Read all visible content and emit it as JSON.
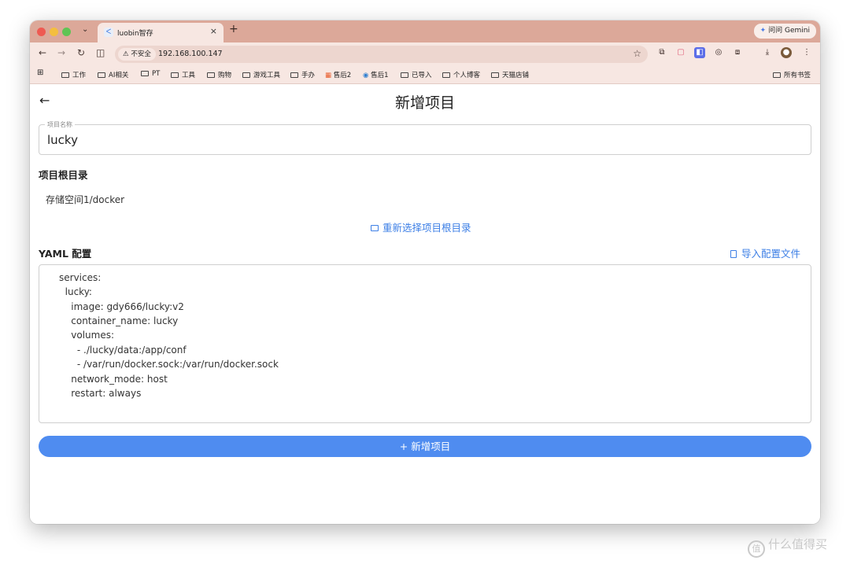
{
  "browser": {
    "tab_title": "luobin智存",
    "tab_favicon": "flutter-icon",
    "new_tab": "+",
    "gemini_label": "问问 Gemini",
    "security_label": "不安全",
    "url": "192.168.100.147",
    "bookmarks": [
      "工作",
      "AI相关",
      "PT",
      "工具",
      "购物",
      "游戏工具",
      "手办",
      "售后2",
      "售后1",
      "已导入",
      "个人博客",
      "天猫店铺"
    ],
    "all_bookmarks": "所有书签"
  },
  "page": {
    "title": "新增项目",
    "project_name": {
      "label": "项目名称",
      "value": "lucky"
    },
    "root_dir": {
      "heading": "项目根目录",
      "value": "存储空间1/docker",
      "reselect_label": "重新选择项目根目录"
    },
    "yaml": {
      "heading": "YAML 配置",
      "import_label": "导入配置文件",
      "lines": [
        "services:",
        "  lucky:",
        "    image: gdy666/lucky:v2",
        "    container_name: lucky",
        "    volumes:",
        "      - ./lucky/data:/app/conf",
        "      - /var/run/docker.sock:/var/run/docker.sock",
        "    network_mode: host",
        "    restart: always"
      ]
    },
    "submit_label": "+  新增项目"
  },
  "watermark": {
    "icon": "值",
    "text": "什么值得买"
  },
  "colors": {
    "accent": "#4f8cf0",
    "link": "#3d7fe6",
    "tabstrip": "#dca899"
  }
}
